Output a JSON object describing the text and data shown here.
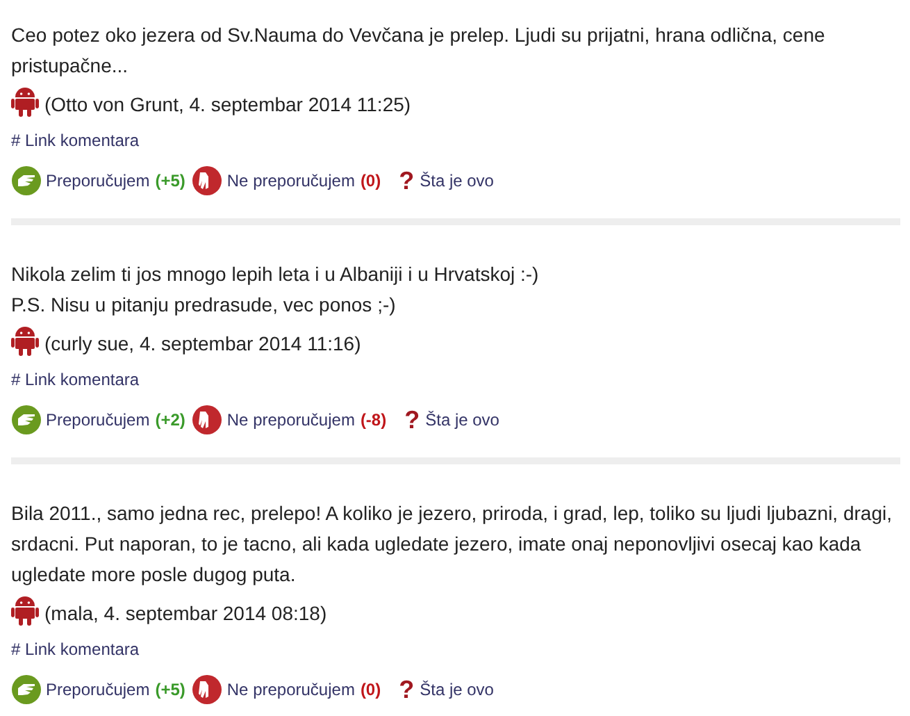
{
  "comments": [
    {
      "lines": [
        "Ceo potez oko jezera od Sv.Nauma do Vevčana je prelep. Ljudi su prijatni, hrana odlična, cene pristupačne..."
      ],
      "meta": "(Otto von Grunt, 4. septembar 2014 11:25)",
      "link": "# Link komentara",
      "recommend": "Preporučujem",
      "recommend_count": "(+5)",
      "not_recommend": "Ne preporučujem",
      "not_recommend_count": "(0)",
      "help_mark": "?",
      "help": "Šta je ovo"
    },
    {
      "lines": [
        "Nikola zelim ti jos mnogo lepih leta i u Albaniji i u Hrvatskoj :-)",
        "P.S. Nisu u pitanju predrasude, vec ponos ;-)"
      ],
      "meta": "(curly sue, 4. septembar 2014 11:16)",
      "link": "# Link komentara",
      "recommend": "Preporučujem",
      "recommend_count": "(+2)",
      "not_recommend": "Ne preporučujem",
      "not_recommend_count": "(-8)",
      "help_mark": "?",
      "help": "Šta je ovo"
    },
    {
      "lines": [
        "Bila 2011., samo jedna rec, prelepo! A koliko je jezero, priroda, i grad, lep, toliko su ljudi ljubazni, dragi, srdacni. Put naporan, to je tacno, ali kada ugledate jezero, imate onaj neponovljivi osecaj kao kada ugledate more posle dugog puta."
      ],
      "meta": "(mala, 4. septembar 2014 08:18)",
      "link": "# Link komentara",
      "recommend": "Preporučujem",
      "recommend_count": "(+5)",
      "not_recommend": "Ne preporučujem",
      "not_recommend_count": "(0)",
      "help_mark": "?",
      "help": "Šta je ovo"
    }
  ]
}
